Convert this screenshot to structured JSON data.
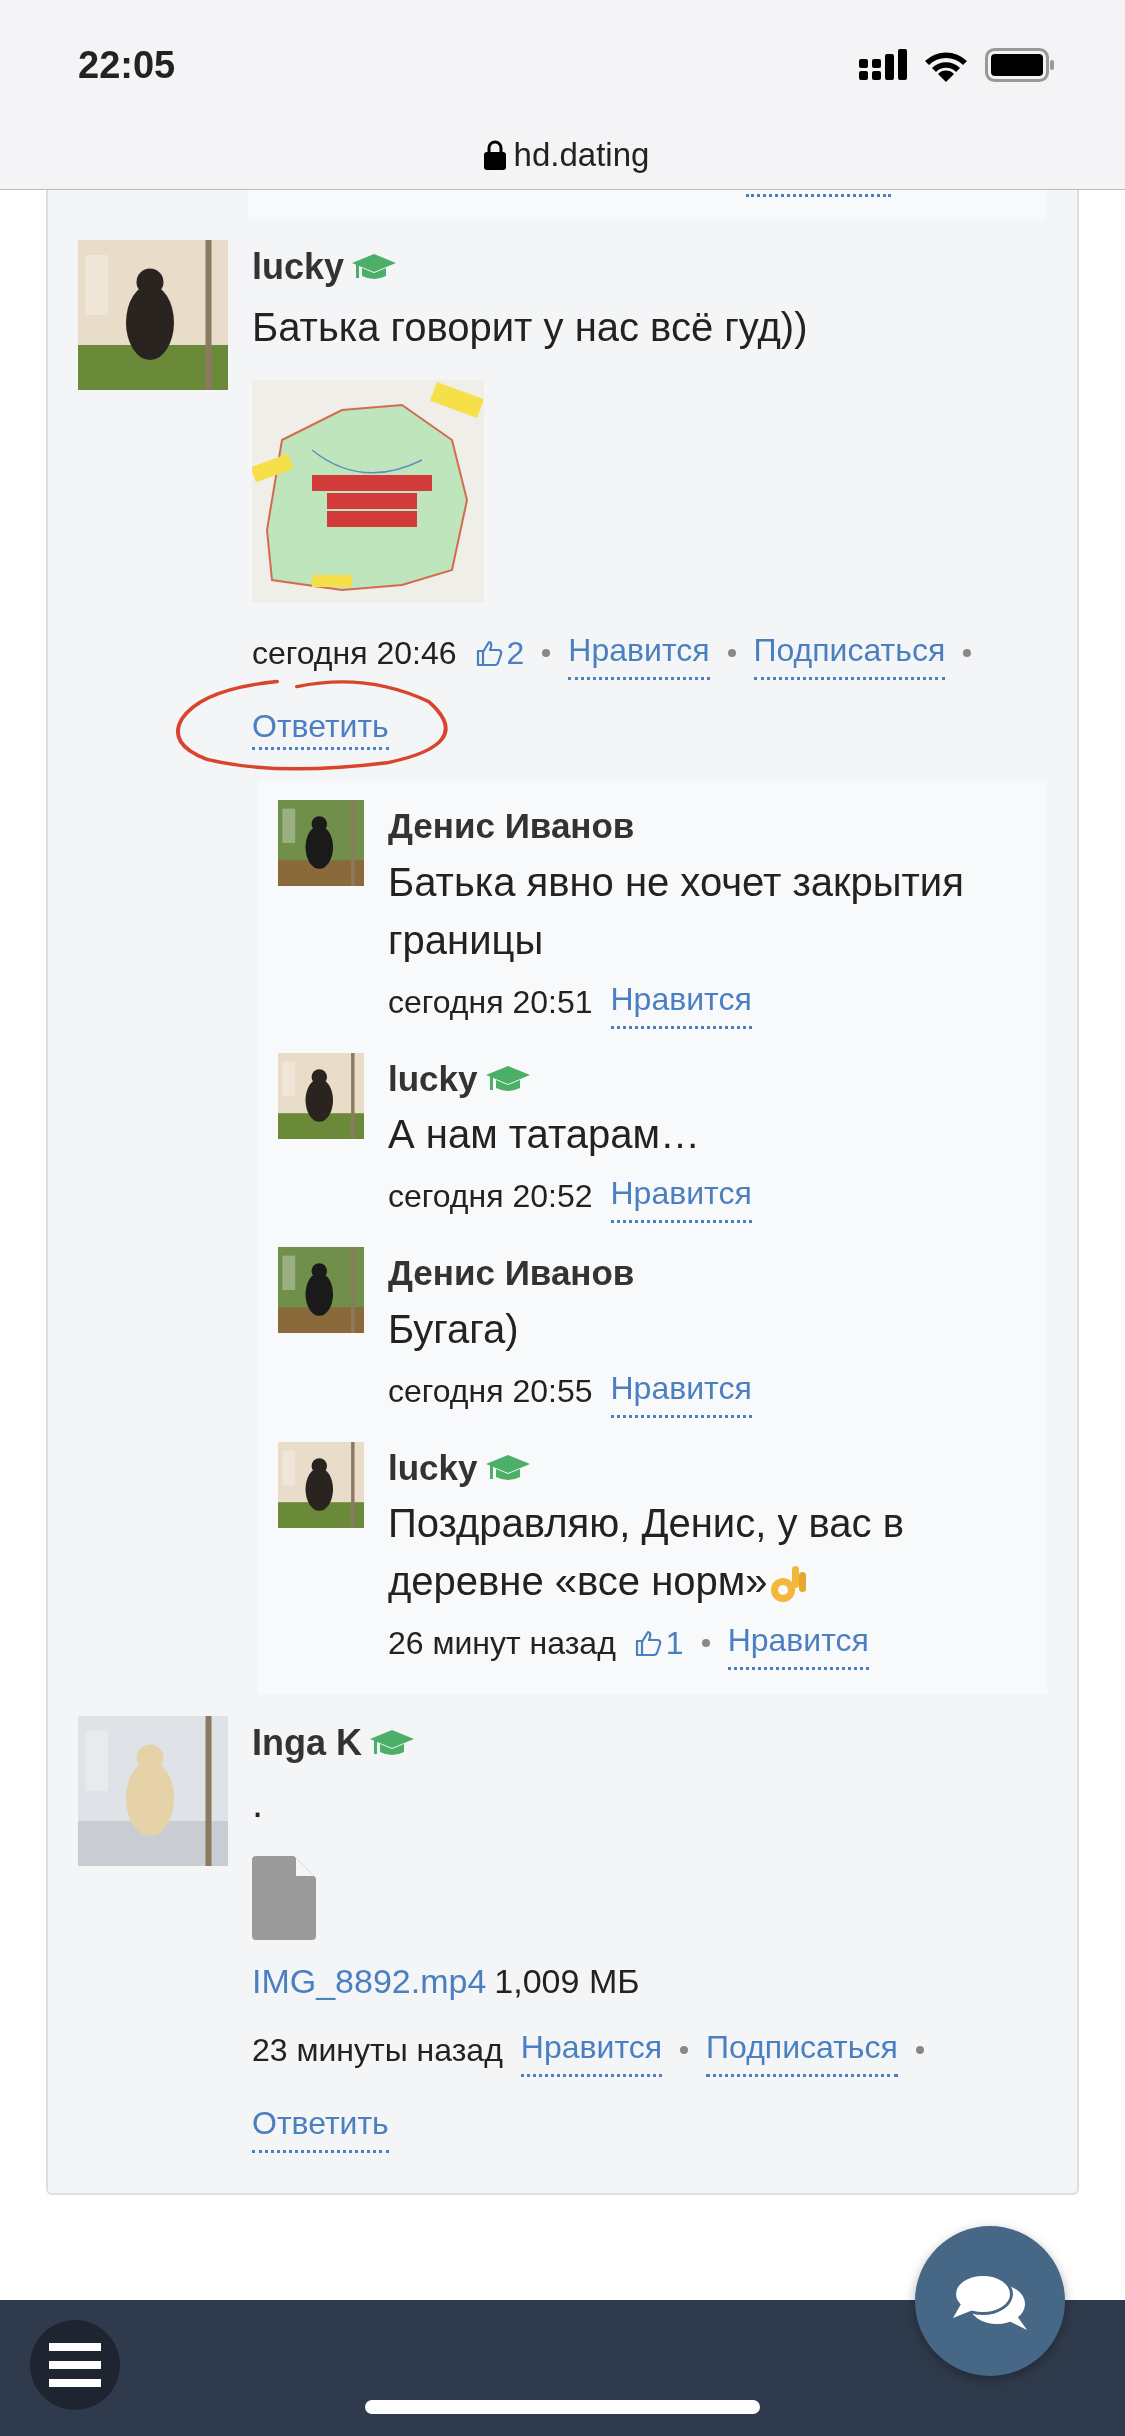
{
  "status_bar": {
    "time": "22:05"
  },
  "address_bar": {
    "url": "hd.dating",
    "secure": true
  },
  "posts": [
    {
      "author": "lucky",
      "badge": true,
      "text": "Батька говорит у нас всё гуд))",
      "attachment": {
        "kind": "picture"
      },
      "time": "сегодня 20:46",
      "likes": "2",
      "actions": [
        {
          "label": "Нравится",
          "circled": false
        },
        {
          "label": "Подписаться",
          "circled": false
        },
        {
          "label": "Ответить",
          "circled": true
        }
      ],
      "replies": [
        {
          "author": "Денис Иванов",
          "badge": false,
          "text": "Батька явно не хочет закрытия границы",
          "emoji": false,
          "time": "сегодня 20:51",
          "actions": [
            {
              "label": "Нравится",
              "circled": false
            }
          ]
        },
        {
          "author": "lucky",
          "badge": true,
          "text": "А нам татарам…",
          "emoji": false,
          "time": "сегодня 20:52",
          "actions": [
            {
              "label": "Нравится",
              "circled": false
            }
          ]
        },
        {
          "author": "Денис Иванов",
          "badge": false,
          "text": "Бугага)",
          "emoji": false,
          "time": "сегодня 20:55",
          "actions": [
            {
              "label": "Нравится",
              "circled": false
            }
          ]
        },
        {
          "author": "lucky",
          "badge": true,
          "text": "Поздравляю, Денис, у вас в деревне «все норм»",
          "emoji": true,
          "time": "26 минут назад",
          "likes": "1",
          "actions": [
            {
              "label": "Нравится",
              "circled": false
            }
          ]
        }
      ]
    },
    {
      "author": "Inga K",
      "badge": true,
      "text": ".",
      "attachment": {
        "kind": "file",
        "name": "IMG_8892.mp4",
        "size": "1,009 МБ"
      },
      "time": "23 минуты назад",
      "actions": [
        {
          "label": "Нравится",
          "circled": false
        },
        {
          "label": "Подписаться",
          "circled": false
        },
        {
          "label": "Ответить",
          "circled": false
        }
      ]
    }
  ]
}
